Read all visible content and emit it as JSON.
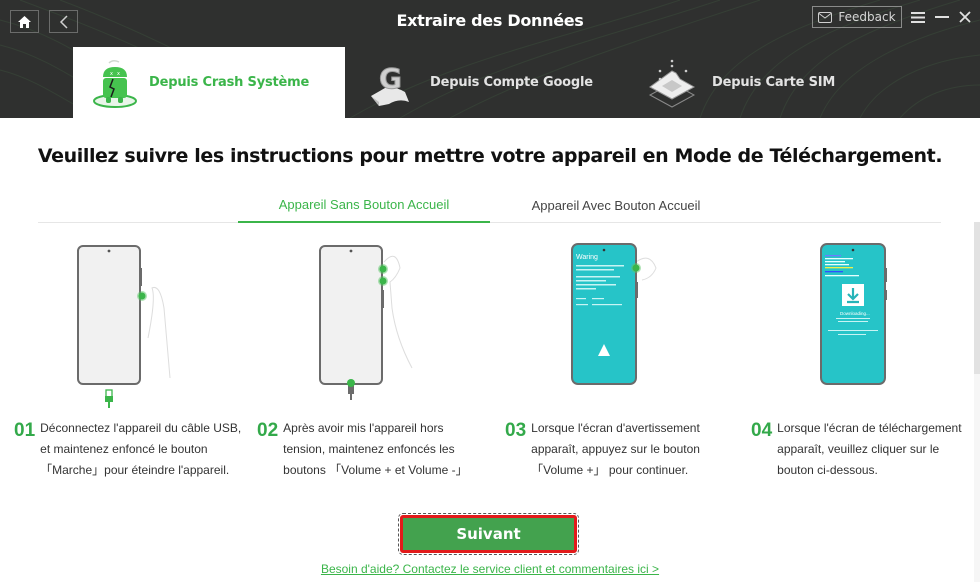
{
  "header": {
    "title": "Extraire des Données",
    "feedback_label": "Feedback",
    "nav": {
      "home_icon": "home-icon",
      "back_icon": "chevron-left-icon"
    },
    "window_controls": [
      "menu-icon",
      "minimize-icon",
      "close-icon"
    ]
  },
  "mode_tabs": [
    {
      "label": "Depuis Crash Système",
      "icon": "broken-android-icon",
      "active": true
    },
    {
      "label": "Depuis Compte Google",
      "icon": "google-account-icon",
      "active": false
    },
    {
      "label": "Depuis Carte SIM",
      "icon": "sim-card-icon",
      "active": false
    }
  ],
  "main": {
    "title": "Veuillez suivre les instructions pour mettre votre appareil en Mode de Téléchargement.",
    "subtabs": [
      {
        "label": "Appareil Sans Bouton Accueil",
        "active": true
      },
      {
        "label": "Appareil Avec Bouton Accueil",
        "active": false
      }
    ],
    "illustrations": {
      "warning_screen_title": "Waring",
      "download_screen_title": "Downloading..."
    },
    "steps": [
      {
        "num": "01",
        "lines": [
          "Déconnectez l'appareil du câble USB,",
          "et maintenez enfoncé le bouton",
          "「Marche」pour éteindre l'appareil."
        ]
      },
      {
        "num": "02",
        "lines": [
          "Après avoir mis l'appareil hors",
          "tension, maintenez enfoncés les",
          "boutons 「Volume + et Volume -」"
        ]
      },
      {
        "num": "03",
        "lines": [
          "Lorsque l'écran d'avertissement",
          "apparaît, appuyez sur le bouton",
          "「Volume +」 pour continuer."
        ]
      },
      {
        "num": "04",
        "lines": [
          "Lorsque l'écran de téléchargement",
          "apparaît, veuillez cliquer sur le",
          "bouton ci-dessous."
        ]
      }
    ],
    "next_button": "Suivant",
    "help_link": "Besoin d'aide? Contactez le service client et commentaires ici >"
  },
  "colors": {
    "accent": "#3bb54a",
    "header_bg": "#2f302f",
    "button_bg": "#43a24e",
    "highlight_border": "#e21a1a",
    "screen_teal": "#2ec4c4"
  }
}
